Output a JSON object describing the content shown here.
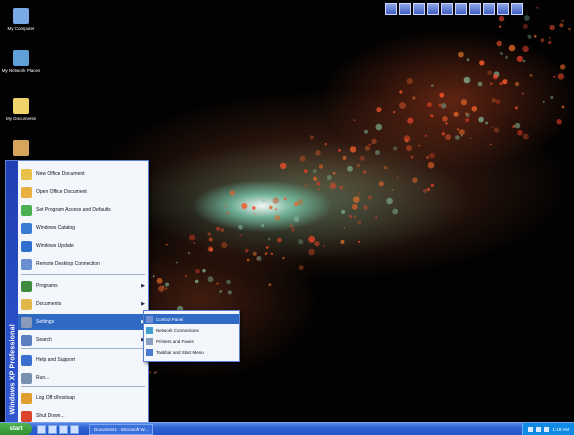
{
  "desktop": {
    "icons": [
      {
        "name": "my-computer-icon",
        "label": "My Computer",
        "color": "#7aa9e8"
      },
      {
        "name": "my-network-places-icon",
        "label": "My Network Places",
        "color": "#5fa0d8"
      },
      {
        "name": "my-documents-icon",
        "label": "My Documents",
        "color": "#f2d36b"
      },
      {
        "name": "recycle-bin-icon",
        "label": "",
        "color": "#d6a45a"
      }
    ],
    "quick_tray_count": 10
  },
  "start_menu": {
    "brand": "Windows XP Professional",
    "items": [
      {
        "name": "new-office-document-icon",
        "label": "New Office Document",
        "color": "#e8c14a",
        "arrow": false
      },
      {
        "name": "open-office-document-icon",
        "label": "Open Office Document",
        "color": "#e8b040",
        "arrow": false
      },
      {
        "name": "set-program-access-icon",
        "label": "Set Program Access and Defaults",
        "color": "#4caf50",
        "arrow": false
      },
      {
        "name": "windows-catalog-icon",
        "label": "Windows Catalog",
        "color": "#3a7bd5",
        "arrow": false
      },
      {
        "name": "windows-update-icon",
        "label": "Windows Update",
        "color": "#2f6fd0",
        "arrow": false
      },
      {
        "name": "remote-desktop-icon",
        "label": "Remote Desktop Connection",
        "color": "#6a8fd0",
        "arrow": false
      },
      {
        "name": "programs-icon",
        "label": "Programs",
        "color": "#3f8a3f",
        "arrow": true
      },
      {
        "name": "documents-icon",
        "label": "Documents",
        "color": "#e0b84a",
        "arrow": true
      },
      {
        "name": "settings-icon",
        "label": "Settings",
        "color": "#8a9ab8",
        "arrow": true
      },
      {
        "name": "search-icon",
        "label": "Search",
        "color": "#5a7fc0",
        "arrow": true
      },
      {
        "name": "help-support-icon",
        "label": "Help and Support",
        "color": "#3a6fd0",
        "arrow": false
      },
      {
        "name": "run-icon",
        "label": "Run...",
        "color": "#7a90b0",
        "arrow": false
      },
      {
        "name": "log-off-icon",
        "label": "Log Off clhostsap",
        "color": "#e0a030",
        "arrow": false
      },
      {
        "name": "shut-down-icon",
        "label": "Shut Down...",
        "color": "#d9442c",
        "arrow": false
      }
    ]
  },
  "settings_submenu": {
    "items": [
      {
        "name": "control-panel-icon",
        "label": "Control Panel",
        "color": "#6e8fd6"
      },
      {
        "name": "network-connections-icon",
        "label": "Network Connections",
        "color": "#3fa0d0"
      },
      {
        "name": "printers-faxes-icon",
        "label": "Printers and Faxes",
        "color": "#8aa0c0"
      },
      {
        "name": "taskbar-start-menu-icon",
        "label": "Taskbar and Start Menu",
        "color": "#4a7ad0"
      }
    ]
  },
  "taskbar": {
    "start_label": "start",
    "task_button_label": "Document1 - Microsoft W...",
    "clock": "1:18 AM"
  }
}
